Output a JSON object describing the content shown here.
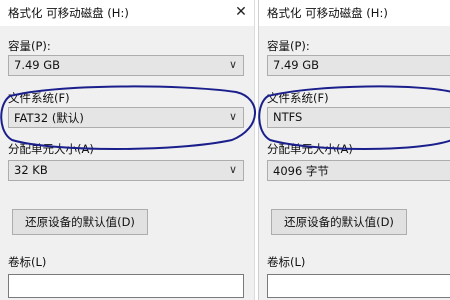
{
  "left": {
    "title": "格式化 可移动磁盘 (H:)",
    "close": "✕",
    "capacity_label": "容量(P):",
    "capacity_value": "7.49 GB",
    "fs_label": "文件系统(F)",
    "fs_value": "FAT32 (默认)",
    "alloc_label": "分配单元大小(A)",
    "alloc_value": "32 KB",
    "restore_label": "还原设备的默认值(D)",
    "volume_label": "卷标(L)"
  },
  "right": {
    "title": "格式化 可移动磁盘 (H:)",
    "capacity_label": "容量(P):",
    "capacity_value": "7.49 GB",
    "fs_label": "文件系统(F)",
    "fs_value": "NTFS",
    "alloc_label": "分配单元大小(A)",
    "alloc_value": "4096 字节",
    "restore_label": "还原设备的默认值(D)",
    "volume_label": "卷标(L)"
  },
  "icons": {
    "chevron": "chevron-down-icon",
    "close": "close-icon"
  },
  "colors": {
    "annotation": "#1a1f8c"
  }
}
